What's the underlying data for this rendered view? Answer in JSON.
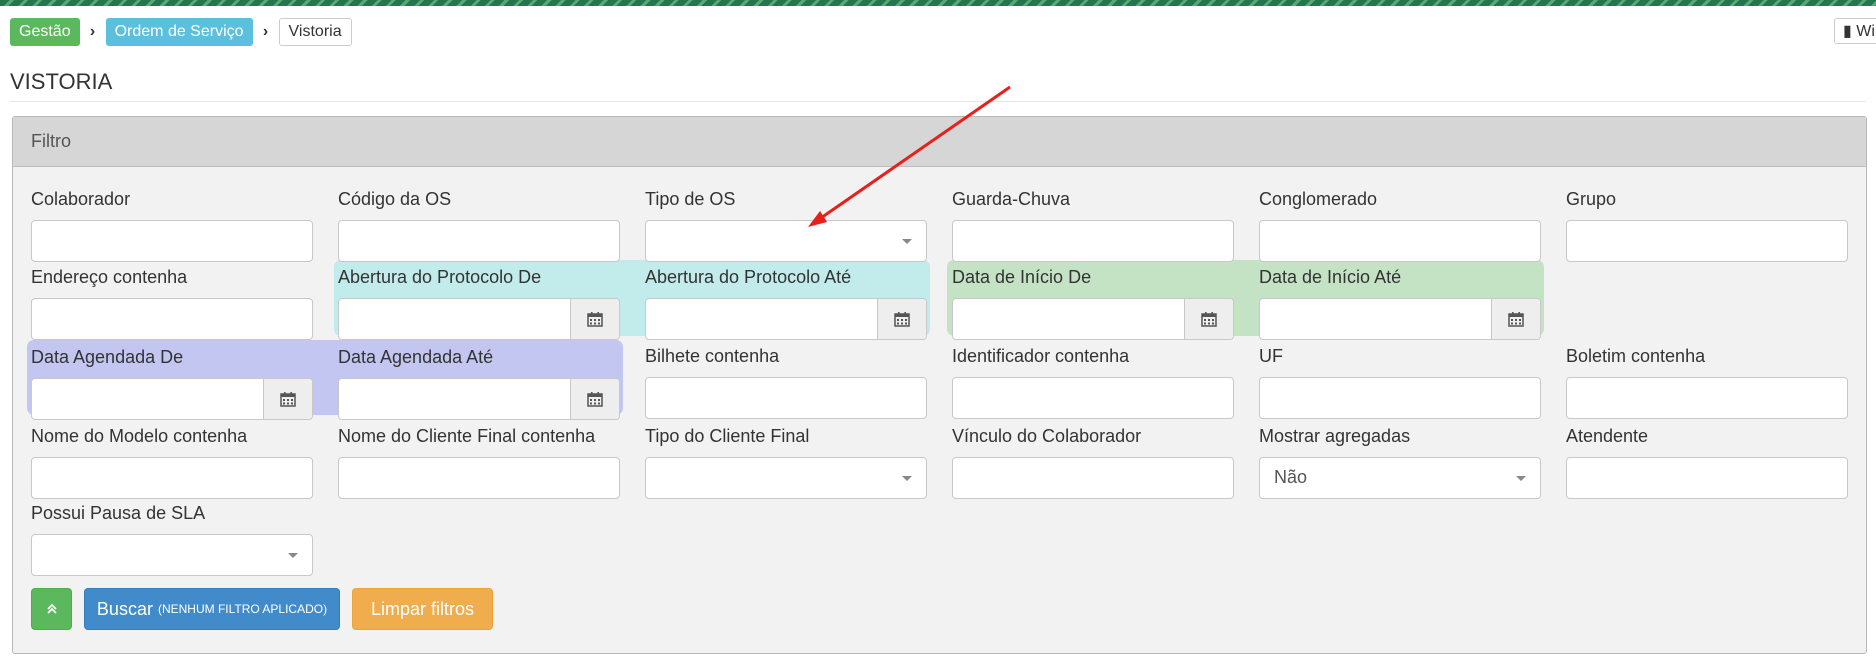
{
  "breadcrumb": {
    "items": [
      "Gestão",
      "Ordem de Serviço",
      "Vistoria"
    ]
  },
  "wiki_label": "Wi",
  "page_title": "VISTORIA",
  "filter_panel": {
    "title": "Filtro",
    "fields": {
      "colaborador": {
        "label": "Colaborador",
        "value": ""
      },
      "codigo_os": {
        "label": "Código da OS",
        "value": ""
      },
      "tipo_os": {
        "label": "Tipo de OS",
        "value": ""
      },
      "guarda_chuva": {
        "label": "Guarda-Chuva",
        "value": ""
      },
      "conglomerado": {
        "label": "Conglomerado",
        "value": ""
      },
      "grupo": {
        "label": "Grupo",
        "value": ""
      },
      "endereco": {
        "label": "Endereço contenha",
        "value": ""
      },
      "abertura_de": {
        "label": "Abertura do Protocolo De",
        "value": ""
      },
      "abertura_ate": {
        "label": "Abertura do Protocolo Até",
        "value": ""
      },
      "inicio_de": {
        "label": "Data de Início De",
        "value": ""
      },
      "inicio_ate": {
        "label": "Data de Início Até",
        "value": ""
      },
      "agendada_de": {
        "label": "Data Agendada De",
        "value": ""
      },
      "agendada_ate": {
        "label": "Data Agendada Até",
        "value": ""
      },
      "bilhete": {
        "label": "Bilhete contenha",
        "value": ""
      },
      "identificador": {
        "label": "Identificador contenha",
        "value": ""
      },
      "uf": {
        "label": "UF",
        "value": ""
      },
      "boletim": {
        "label": "Boletim contenha",
        "value": ""
      },
      "nome_modelo": {
        "label": "Nome do Modelo contenha",
        "value": ""
      },
      "nome_cliente": {
        "label": "Nome do Cliente Final contenha",
        "value": ""
      },
      "tipo_cliente": {
        "label": "Tipo do Cliente Final",
        "value": ""
      },
      "vinculo": {
        "label": "Vínculo do Colaborador",
        "value": ""
      },
      "mostrar_agregadas": {
        "label": "Mostrar agregadas",
        "value": "Não"
      },
      "atendente": {
        "label": "Atendente",
        "value": ""
      },
      "pausa_sla": {
        "label": "Possui Pausa de SLA",
        "value": ""
      }
    },
    "highlight_colors": {
      "abertura": "#c2ebeb",
      "inicio": "#c4e3c4",
      "agendada": "#c3c6f0"
    }
  },
  "actions": {
    "collapse_icon": "double-chevron-up-icon",
    "search_label": "Buscar",
    "search_note": "(NENHUM FILTRO APLICADO)",
    "clear_label": "Limpar filtros"
  },
  "colors": {
    "gestao": "#5cb85c",
    "ordem": "#5bc0de",
    "primary": "#428bca",
    "warning": "#f0ad4e",
    "success": "#5cb85c",
    "annotation_arrow": "#e8201c"
  }
}
